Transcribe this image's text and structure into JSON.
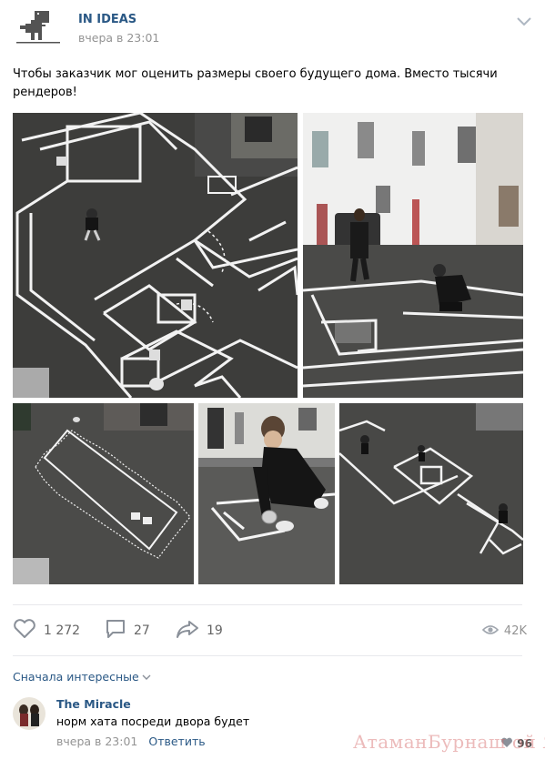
{
  "post": {
    "author": "IN IDEAS",
    "time": "вчера в 23:01",
    "text": "Чтобы заказчик мог оценить размеры своего будущего дома. Вместо тысячи рендеров!",
    "avatar_icon": "dinosaur-icon",
    "menu_icon": "chevron-down-icon"
  },
  "actions": {
    "likes": "1 272",
    "comments": "27",
    "shares": "19",
    "views": "42K",
    "like_icon": "heart-icon",
    "comment_icon": "speech-bubble-icon",
    "share_icon": "share-arrow-icon",
    "views_icon": "eye-icon"
  },
  "comments_section": {
    "sort_label": "Сначала интересные",
    "items": [
      {
        "author": "The Miracle",
        "text": "норм хата посреди двора будет",
        "time": "вчера в 23:01",
        "reply_label": "Ответить",
        "likes": "96"
      }
    ]
  },
  "watermark": "АтаманБурнаш ой ЯП",
  "colors": {
    "link": "#2a5885",
    "muted": "#939393",
    "asphalt": "#3a3a3a",
    "tape": "#f4f4f4"
  }
}
